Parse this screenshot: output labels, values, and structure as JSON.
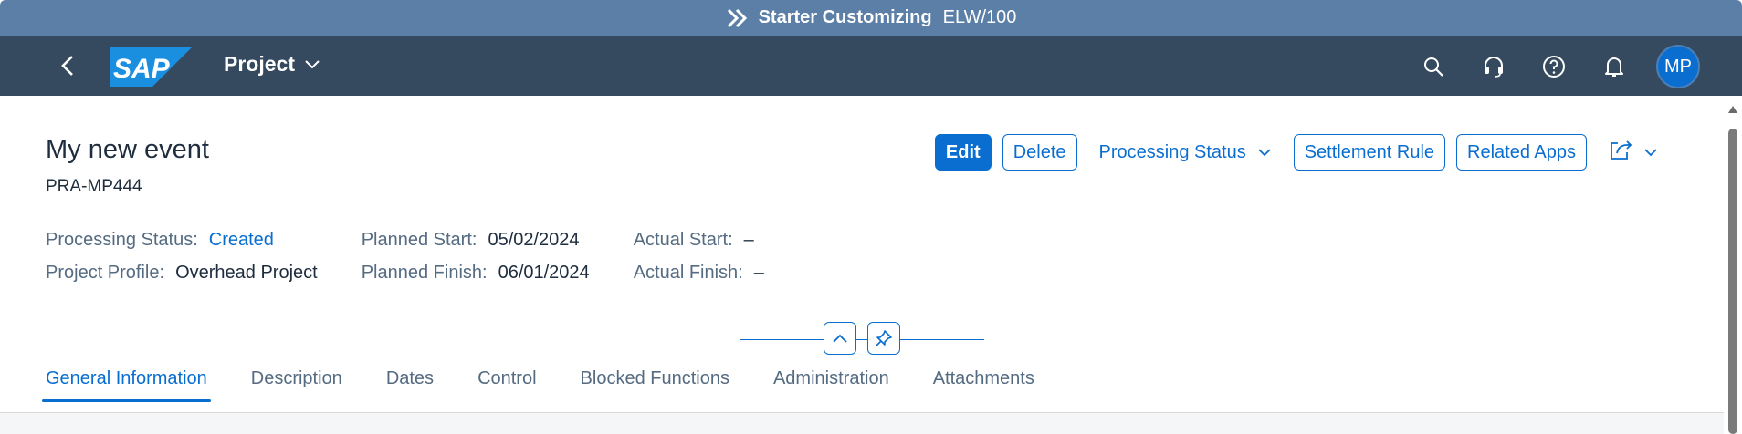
{
  "system_bar": {
    "app_name": "Starter Customizing",
    "system_id": "ELW/100"
  },
  "shell": {
    "title": "Project",
    "avatar_initials": "MP"
  },
  "header": {
    "title": "My new event",
    "subtitle": "PRA-MP444"
  },
  "toolbar": {
    "edit": "Edit",
    "delete": "Delete",
    "processing_status": "Processing Status",
    "settlement_rule": "Settlement Rule",
    "related_apps": "Related Apps"
  },
  "facets": {
    "processing_status_label": "Processing Status:",
    "processing_status_value": "Created",
    "project_profile_label": "Project Profile:",
    "project_profile_value": "Overhead Project",
    "planned_start_label": "Planned Start:",
    "planned_start_value": "05/02/2024",
    "planned_finish_label": "Planned Finish:",
    "planned_finish_value": "06/01/2024",
    "actual_start_label": "Actual Start:",
    "actual_start_value": "–",
    "actual_finish_label": "Actual Finish:",
    "actual_finish_value": "–"
  },
  "tabs": [
    {
      "label": "General Information"
    },
    {
      "label": "Description"
    },
    {
      "label": "Dates"
    },
    {
      "label": "Control"
    },
    {
      "label": "Blocked Functions"
    },
    {
      "label": "Administration"
    },
    {
      "label": "Attachments"
    }
  ],
  "colors": {
    "system_bar": "#5b7fa6",
    "shell_bar": "#354a5f",
    "accent": "#0a6ed1"
  }
}
